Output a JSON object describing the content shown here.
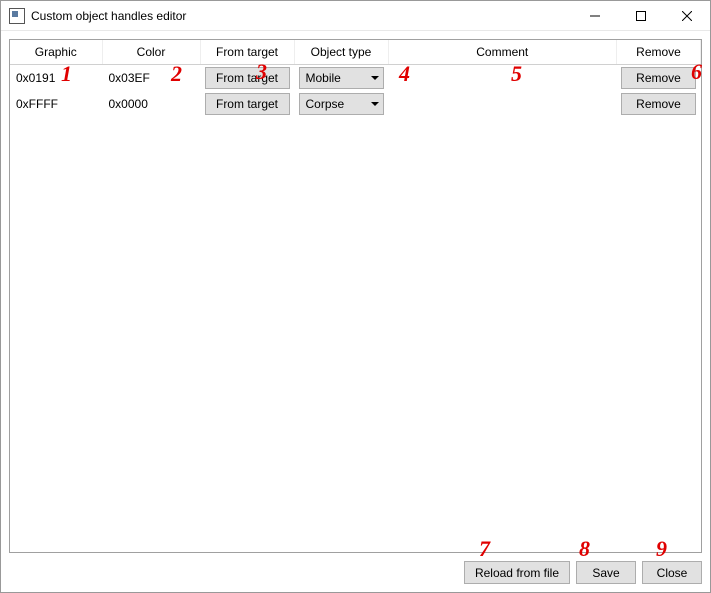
{
  "window": {
    "title": "Custom object handles editor"
  },
  "columns": {
    "graphic": "Graphic",
    "color": "Color",
    "from_target": "From target",
    "object_type": "Object type",
    "comment": "Comment",
    "remove": "Remove"
  },
  "rows": [
    {
      "graphic": "0x0191",
      "color": "0x03EF",
      "from_target_btn": "From target",
      "object_type": "Mobile",
      "comment": "",
      "remove_btn": "Remove"
    },
    {
      "graphic": "0xFFFF",
      "color": "0x0000",
      "from_target_btn": "From target",
      "object_type": "Corpse",
      "comment": "",
      "remove_btn": "Remove"
    }
  ],
  "footer": {
    "reload": "Reload from file",
    "save": "Save",
    "close": "Close"
  },
  "annotations": {
    "a1": "1",
    "a2": "2",
    "a3": "3",
    "a4": "4",
    "a5": "5",
    "a6": "6",
    "a7": "7",
    "a8": "8",
    "a9": "9"
  }
}
